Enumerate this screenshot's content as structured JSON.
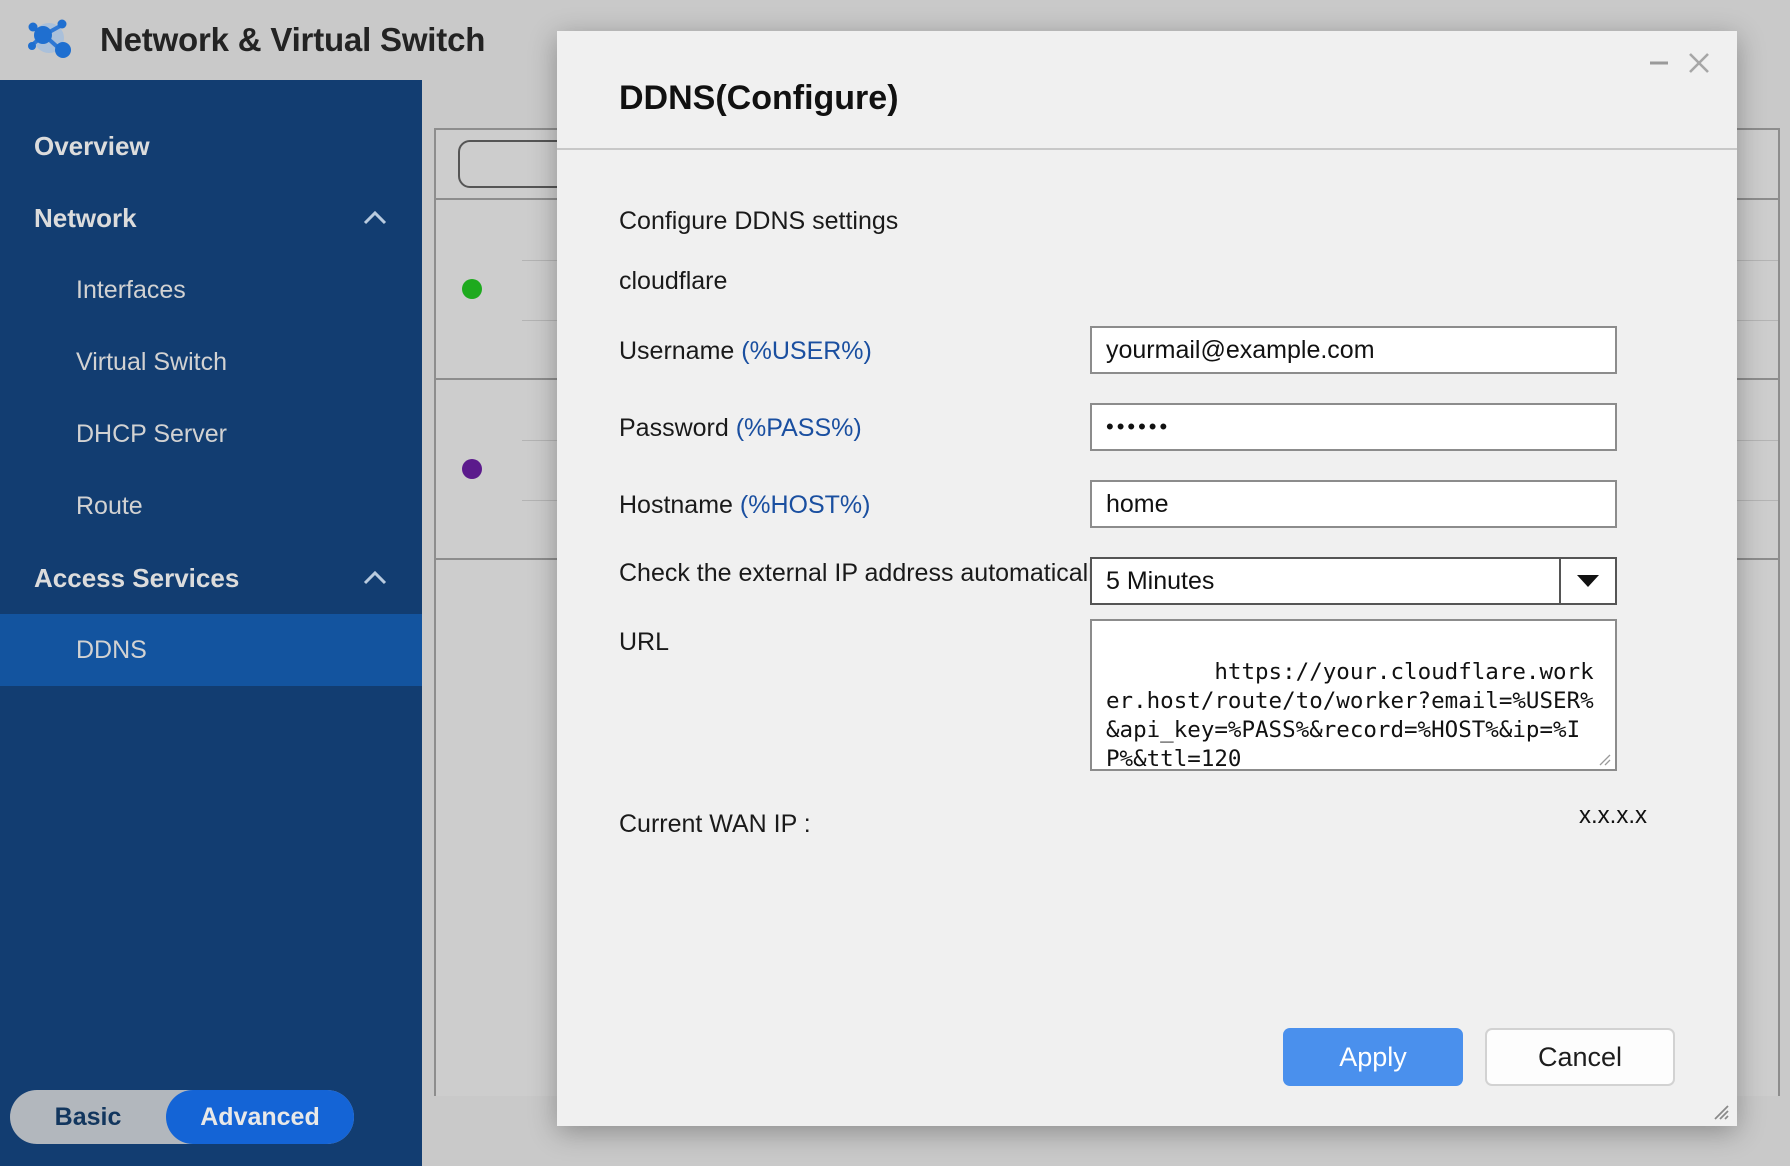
{
  "app": {
    "title": "Network & Virtual Switch",
    "logo_icon": "network-nodes-icon"
  },
  "sidebar": {
    "items": [
      {
        "label": "Overview",
        "type": "group",
        "expanded": false,
        "selected": false
      },
      {
        "label": "Network",
        "type": "group",
        "expanded": true,
        "selected": false
      },
      {
        "label": "Interfaces",
        "type": "sub",
        "selected": false
      },
      {
        "label": "Virtual Switch",
        "type": "sub",
        "selected": false
      },
      {
        "label": "DHCP Server",
        "type": "sub",
        "selected": false
      },
      {
        "label": "Route",
        "type": "sub",
        "selected": false
      },
      {
        "label": "Access Services",
        "type": "group",
        "expanded": true,
        "selected": false
      },
      {
        "label": "DDNS",
        "type": "sub",
        "selected": true
      }
    ],
    "mode_toggle": {
      "basic_label": "Basic",
      "advanced_label": "Advanced",
      "selected": "Advanced"
    },
    "colors": {
      "bg": "#123d71",
      "selected": "#13549f",
      "accent": "#1464d6"
    }
  },
  "background_table": {
    "rows": [
      {
        "status_color": "#1eaa1e",
        "status_name": "status-dot-green"
      },
      {
        "status_color": "#5b1a8c",
        "status_name": "status-dot-purple"
      }
    ]
  },
  "dialog": {
    "title": "DDNS(Configure)",
    "minimize_icon": "minimize-icon",
    "close_icon": "close-icon",
    "resize_grip_icon": "resize-grip-icon",
    "section_heading": "Configure DDNS settings",
    "provider": "cloudflare",
    "fields": {
      "username": {
        "label": "Username",
        "token": "(%USER%)",
        "value": "yourmail@example.com"
      },
      "password": {
        "label": "Password",
        "token": "(%PASS%)",
        "value": "••••••"
      },
      "hostname": {
        "label": "Hostname",
        "token": "(%HOST%)",
        "value": "home"
      },
      "check_interval": {
        "label": "Check the external IP address automatically",
        "value": "5 Minutes",
        "dropdown_icon": "chevron-down-icon"
      },
      "url": {
        "label": "URL",
        "value": "https://your.cloudflare.worker.host/route/to/worker?email=%USER%&api_key=%PASS%&record=%HOST%&ip=%IP%&ttl=120"
      },
      "current_wan_ip": {
        "label": "Current WAN IP :",
        "value": "x.x.x.x"
      }
    },
    "buttons": {
      "apply": "Apply",
      "cancel": "Cancel"
    },
    "colors": {
      "apply_bg": "#4a90ed",
      "token_text": "#1a4fa0",
      "body_bg": "#f0f0f0"
    }
  }
}
